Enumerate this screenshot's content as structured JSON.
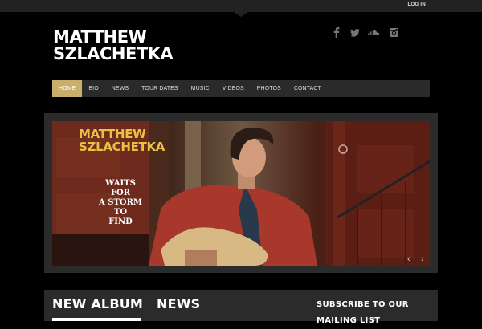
{
  "header": {
    "login_label": "LOG IN",
    "title_line1": "MATTHEW",
    "title_line2": "SZLACHETKA",
    "social_icons": [
      "facebook-icon",
      "twitter-icon",
      "soundcloud-icon",
      "instagram-icon"
    ]
  },
  "nav": {
    "items": [
      {
        "label": "HOME",
        "active": true
      },
      {
        "label": "BIO"
      },
      {
        "label": "NEWS"
      },
      {
        "label": "TOUR DATES"
      },
      {
        "label": "MUSIC"
      },
      {
        "label": "VIDEOS"
      },
      {
        "label": "PHOTOS"
      },
      {
        "label": "CONTACT"
      }
    ]
  },
  "slider": {
    "artist_line1": "MATTHEW",
    "artist_line2": "SZLACHETKA",
    "tagline": [
      "WAITS",
      "FOR",
      "A STORM",
      "TO",
      "FIND"
    ],
    "prev_glyph": "‹",
    "next_glyph": "›"
  },
  "bottom": {
    "album_heading": "NEW ALBUM",
    "news_heading": "NEWS",
    "subscribe_heading": "SUBSCRIBE TO OUR MAILING LIST"
  },
  "colors": {
    "accent": "#c9ae6c",
    "slide_title": "#e8c244",
    "background": "#000000",
    "panel": "#2b2b2b"
  }
}
